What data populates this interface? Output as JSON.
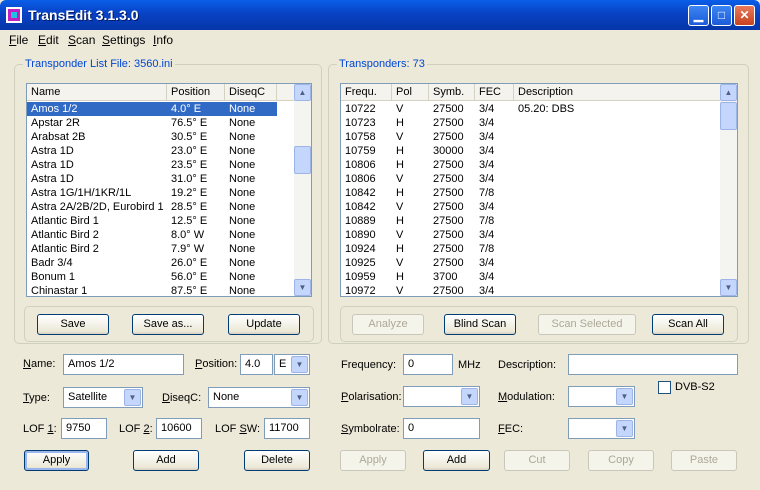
{
  "window": {
    "title": "TransEdit 3.1.3.0",
    "min": "▁",
    "max": "□",
    "close": "✕"
  },
  "menu": [
    {
      "u": "F",
      "rest": "ile"
    },
    {
      "u": "E",
      "rest": "dit"
    },
    {
      "u": "S",
      "rest": "can"
    },
    {
      "u": "S",
      "rest": "ettings"
    },
    {
      "u": "I",
      "rest": "nfo"
    }
  ],
  "left": {
    "group_title": "Transponder List File:  3560.ini",
    "columns": [
      "Name",
      "Position",
      "DiseqC"
    ],
    "rows": [
      [
        "Amos 1/2",
        "4.0° E",
        "None"
      ],
      [
        "Apstar 2R",
        "76.5° E",
        "None"
      ],
      [
        "Arabsat 2B",
        "30.5° E",
        "None"
      ],
      [
        "Astra 1D",
        "23.0° E",
        "None"
      ],
      [
        "Astra 1D",
        "23.5° E",
        "None"
      ],
      [
        "Astra 1D",
        "31.0° E",
        "None"
      ],
      [
        "Astra 1G/1H/1KR/1L",
        "19.2° E",
        "None"
      ],
      [
        "Astra 2A/2B/2D, Eurobird 1",
        "28.5° E",
        "None"
      ],
      [
        "Atlantic Bird 1",
        "12.5° E",
        "None"
      ],
      [
        "Atlantic Bird 2",
        "8.0° W",
        "None"
      ],
      [
        "Atlantic Bird 2",
        "7.9° W",
        "None"
      ],
      [
        "Badr 3/4",
        "26.0° E",
        "None"
      ],
      [
        "Bonum 1",
        "56.0° E",
        "None"
      ],
      [
        "Chinastar 1",
        "87.5° E",
        "None"
      ]
    ],
    "buttons": {
      "save": "Save",
      "save_as": "Save as...",
      "update": "Update"
    },
    "form": {
      "name_label_u": "N",
      "name_label_rest": "ame:",
      "name_value": "Amos 1/2",
      "position_label_u": "P",
      "position_label_rest": "osition:",
      "position_value": "4.0",
      "position_dir": "E",
      "type_label_u": "T",
      "type_label_rest": "ype:",
      "type_value": "Satellite",
      "diseqc_label_u": "D",
      "diseqc_label_rest": "iseqC:",
      "diseqc_value": "None",
      "lof1_label_pre": "LOF ",
      "lof1_label_u": "1",
      "lof1_label_post": ":",
      "lof1_value": "9750",
      "lof2_label_pre": "LOF ",
      "lof2_label_u": "2",
      "lof2_label_post": ":",
      "lof2_value": "10600",
      "lofsw_label_pre": "LOF ",
      "lofsw_label_u": "S",
      "lofsw_label_post": "W:",
      "lofsw_value": "11700"
    },
    "action_buttons": {
      "apply": "Apply",
      "add": "Add",
      "delete": "Delete"
    }
  },
  "right": {
    "group_title": "Transponders: 73",
    "columns": [
      "Frequ.",
      "Pol",
      "Symb.",
      "FEC",
      "Description"
    ],
    "rows": [
      [
        "10722",
        "V",
        "27500",
        "3/4",
        "05.20: DBS"
      ],
      [
        "10723",
        "H",
        "27500",
        "3/4",
        ""
      ],
      [
        "10758",
        "V",
        "27500",
        "3/4",
        ""
      ],
      [
        "10759",
        "H",
        "30000",
        "3/4",
        ""
      ],
      [
        "10806",
        "H",
        "27500",
        "3/4",
        ""
      ],
      [
        "10806",
        "V",
        "27500",
        "3/4",
        ""
      ],
      [
        "10842",
        "H",
        "27500",
        "7/8",
        ""
      ],
      [
        "10842",
        "V",
        "27500",
        "3/4",
        ""
      ],
      [
        "10889",
        "H",
        "27500",
        "7/8",
        ""
      ],
      [
        "10890",
        "V",
        "27500",
        "3/4",
        ""
      ],
      [
        "10924",
        "H",
        "27500",
        "7/8",
        ""
      ],
      [
        "10925",
        "V",
        "27500",
        "3/4",
        ""
      ],
      [
        "10959",
        "H",
        "3700",
        "3/4",
        ""
      ],
      [
        "10972",
        "V",
        "27500",
        "3/4",
        ""
      ]
    ],
    "buttons": {
      "analyze": "Analyze",
      "blind_scan": "Blind Scan",
      "scan_selected": "Scan Selected",
      "scan_all": "Scan All"
    },
    "form": {
      "frequency_label": "Frequency:",
      "frequency_value": "0",
      "frequency_unit": "MHz",
      "description_label": "Description:",
      "description_value": "",
      "polarisation_label_u": "P",
      "polarisation_label_rest": "olarisation:",
      "polarisation_value": "",
      "modulation_label_u": "M",
      "modulation_label_rest": "odulation:",
      "modulation_value": "",
      "dvbs2_label": "DVB-S2",
      "symbolrate_label_u": "S",
      "symbolrate_label_rest": "ymbolrate:",
      "symbolrate_value": "0",
      "fec_label_u": "F",
      "fec_label_rest": "EC:",
      "fec_value": ""
    },
    "action_buttons": {
      "apply": "Apply",
      "add": "Add",
      "cut": "Cut",
      "copy": "Copy",
      "paste": "Paste"
    }
  },
  "colors": {
    "selection": "#316ac5",
    "group_title": "#0046d5",
    "titlebar": "#0842c4"
  }
}
